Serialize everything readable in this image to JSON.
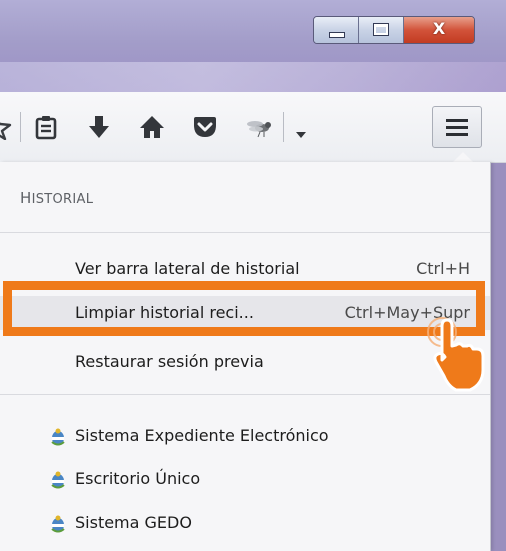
{
  "window": {
    "minimize_icon": "minimize-icon",
    "maximize_icon": "maximize-icon",
    "close_icon": "close-icon",
    "close_glyph": "X"
  },
  "toolbar": {
    "icons": [
      "bookmark-star-icon",
      "reading-list-icon",
      "download-icon",
      "home-icon",
      "pocket-icon",
      "extension-fly-icon",
      "dropdown-icon",
      "hamburger-menu-icon"
    ]
  },
  "history_panel": {
    "header_first": "H",
    "header_rest": "ISTORIAL",
    "items": [
      {
        "label": "Ver barra lateral de historial",
        "shortcut": "Ctrl+H"
      },
      {
        "label": "Limpiar historial reci...",
        "shortcut": "Ctrl+May+Supr"
      },
      {
        "label": "Restaurar sesión previa",
        "shortcut": ""
      }
    ],
    "recent": [
      {
        "label": "Sistema Expediente Electrónico",
        "icon": "argentina-coat-of-arms-icon"
      },
      {
        "label": "Escritorio Único",
        "icon": "argentina-coat-of-arms-icon"
      },
      {
        "label": "Sistema GEDO",
        "icon": "argentina-coat-of-arms-icon"
      }
    ]
  },
  "colors": {
    "highlight": "#ef7a1a",
    "accent_hand": "#ef7a1a"
  }
}
